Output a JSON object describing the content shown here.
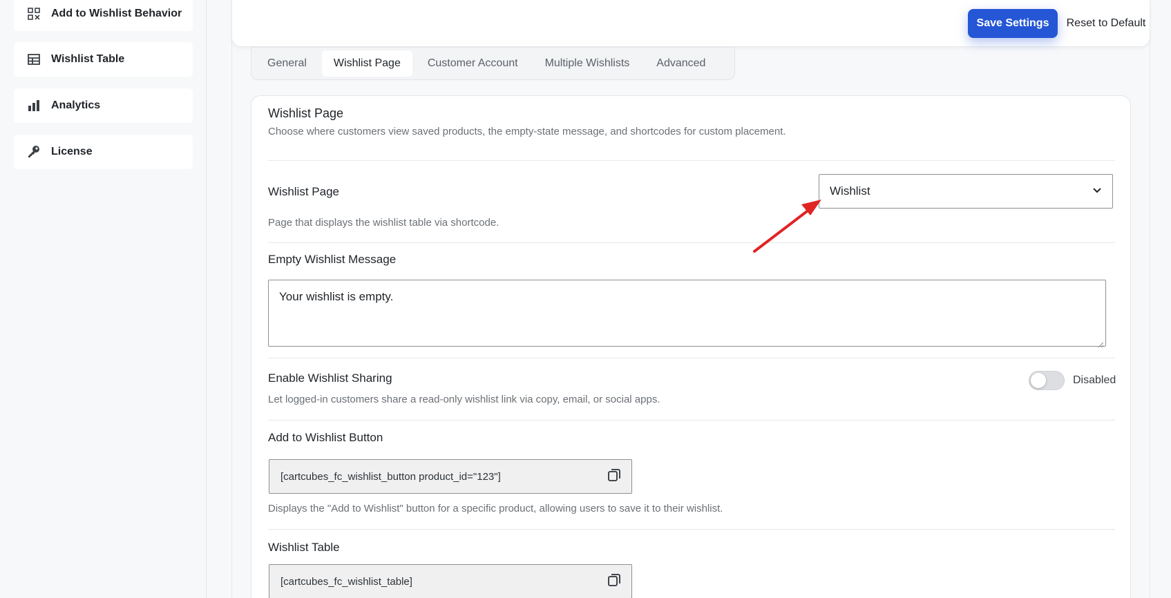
{
  "sidebar": {
    "items": [
      {
        "label": "Add to Wishlist Behavior",
        "icon": "grid-icon"
      },
      {
        "label": "Wishlist Table",
        "icon": "table-icon"
      },
      {
        "label": "Analytics",
        "icon": "bar-chart-icon"
      },
      {
        "label": "License",
        "icon": "key-icon"
      }
    ]
  },
  "header": {
    "save_label": "Save Settings",
    "reset_label": "Reset to Default"
  },
  "tabs": [
    {
      "label": "General",
      "active": false
    },
    {
      "label": "Wishlist Page",
      "active": true
    },
    {
      "label": "Customer Account",
      "active": false
    },
    {
      "label": "Multiple Wishlists",
      "active": false
    },
    {
      "label": "Advanced",
      "active": false
    }
  ],
  "section": {
    "title": "Wishlist Page",
    "description": "Choose where customers view saved products, the empty-state message, and shortcodes for custom placement."
  },
  "fields": {
    "wishlist_page": {
      "label": "Wishlist Page",
      "value": "Wishlist",
      "help": "Page that displays the wishlist table via shortcode."
    },
    "empty_message": {
      "label": "Empty Wishlist Message",
      "value": "Your wishlist is empty."
    },
    "sharing": {
      "label": "Enable Wishlist Sharing",
      "state": "Disabled",
      "help": "Let logged-in customers share a read-only wishlist link via copy, email, or social apps."
    },
    "button_shortcode": {
      "label": "Add to Wishlist Button",
      "code": "[cartcubes_fc_wishlist_button product_id=\"123\"]",
      "help": "Displays the \"Add to Wishlist\" button for a specific product, allowing users to save it to their wishlist."
    },
    "table_shortcode": {
      "label": "Wishlist Table",
      "code": "[cartcubes_fc_wishlist_table]"
    }
  },
  "colors": {
    "accent": "#2556d6",
    "annotation_arrow": "#e02424"
  }
}
